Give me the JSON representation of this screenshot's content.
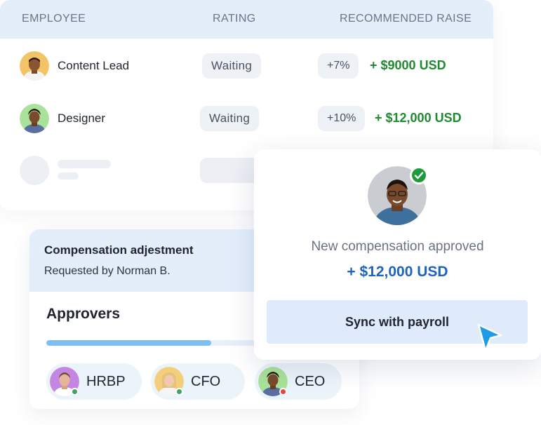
{
  "table": {
    "headers": [
      "EMPLOYEE",
      "RATING",
      "RECOMMENDED RAISE"
    ],
    "rows": [
      {
        "name": "Content Lead",
        "rating": "Waiting",
        "percent": "+7%",
        "raise": "+ $9000 USD"
      },
      {
        "name": "Designer",
        "rating": "Waiting",
        "percent": "+10%",
        "raise": "+ $12,000 USD"
      }
    ]
  },
  "compensation": {
    "title": "Compensation adjestment",
    "requested_by": "Requested by Norman B.",
    "approvers_title": "Approvers",
    "progress_fraction": 0.56,
    "approvers": [
      {
        "label": "HRBP",
        "status_color": "#3ea55a"
      },
      {
        "label": "CFO",
        "status_color": "#3ea55a"
      },
      {
        "label": "CEO",
        "status_color": "#e2483d"
      }
    ]
  },
  "approval": {
    "message": "New compensation approved",
    "amount": "+ $12,000 USD",
    "button_label": "Sync with payroll"
  },
  "colors": {
    "accent_blue": "#1d63c2",
    "raise_green": "#1f8a2e",
    "check_green": "#1f9a3a",
    "cursor_blue": "#1e9be8"
  },
  "icons": {
    "check": "check-icon",
    "cursor": "cursor-arrow-icon"
  }
}
